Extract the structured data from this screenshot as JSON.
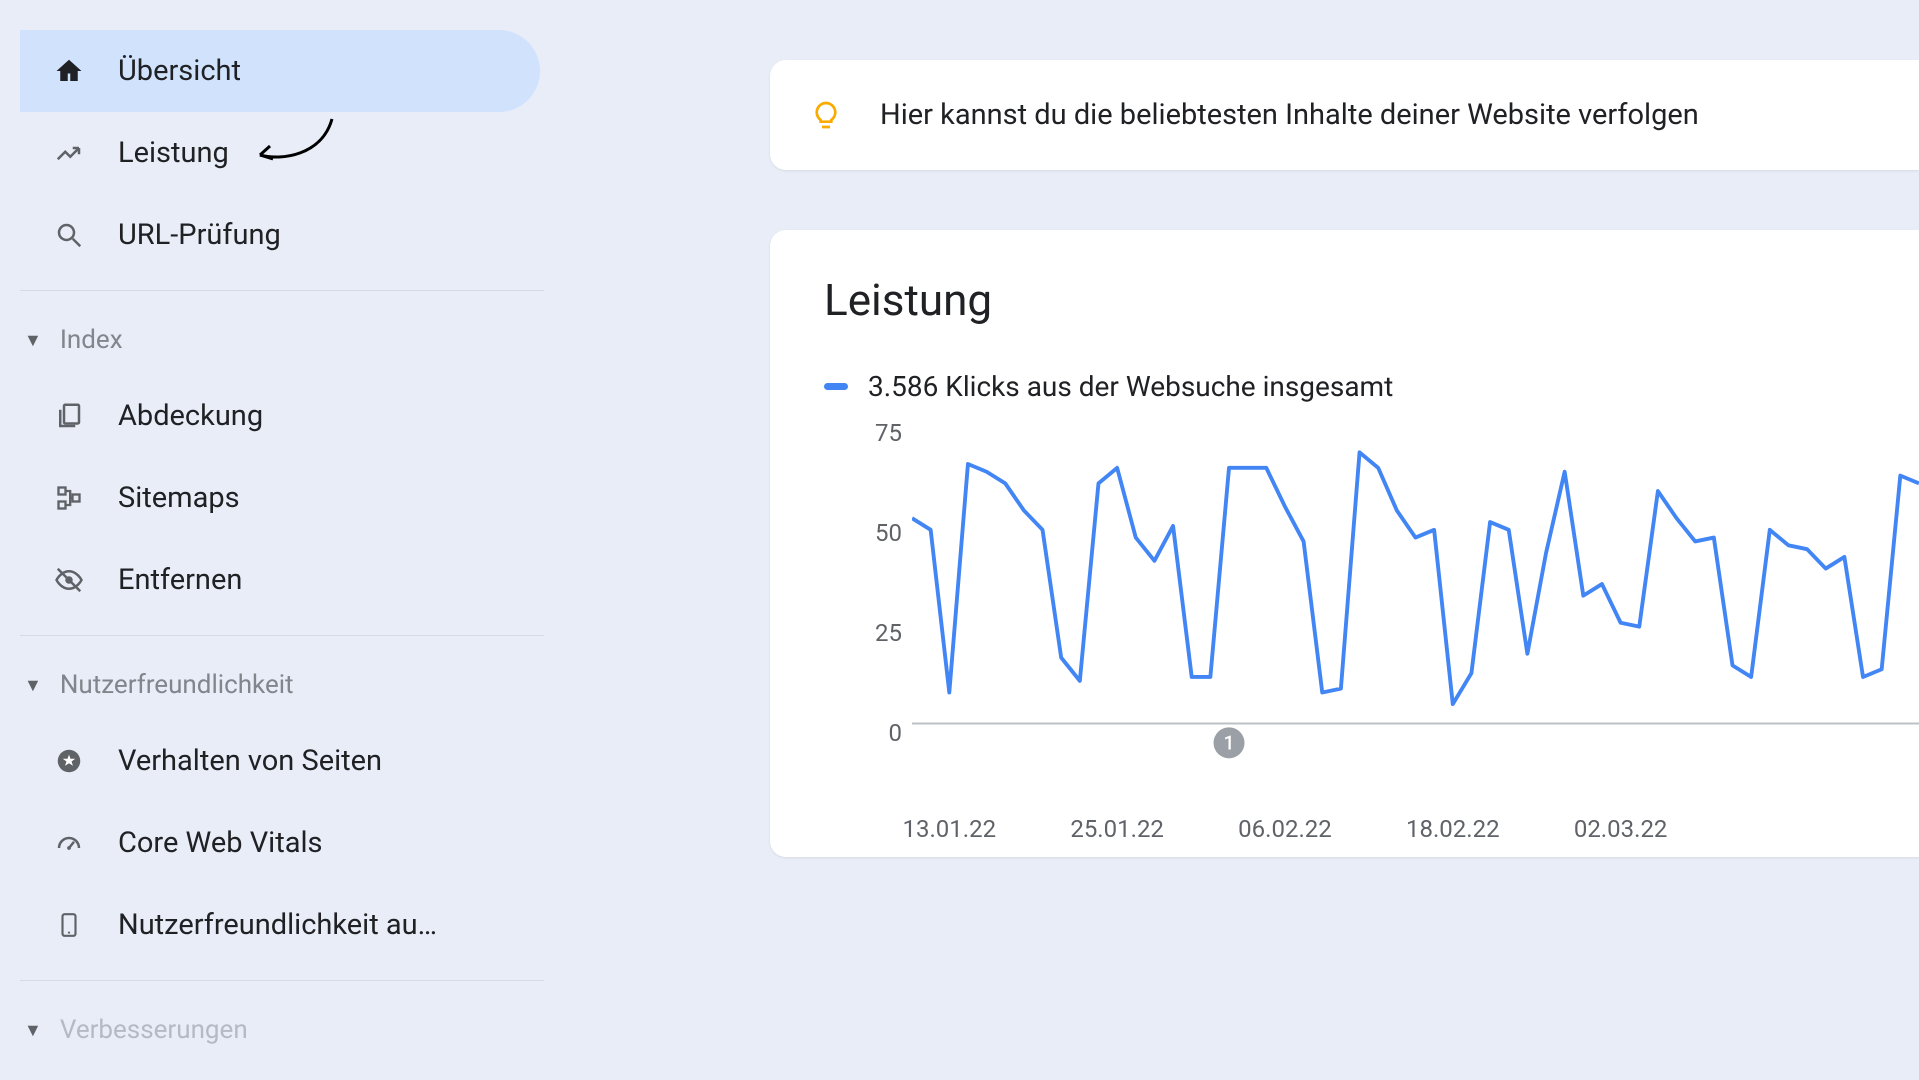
{
  "sidebar": {
    "main_items": [
      {
        "label": "Übersicht",
        "icon": "home-icon",
        "selected": true
      },
      {
        "label": "Leistung",
        "icon": "trending-icon",
        "selected": false
      },
      {
        "label": "URL-Prüfung",
        "icon": "search-icon",
        "selected": false
      }
    ],
    "sections": [
      {
        "title": "Index",
        "items": [
          {
            "label": "Abdeckung",
            "icon": "copy-icon"
          },
          {
            "label": "Sitemaps",
            "icon": "sitemap-icon"
          },
          {
            "label": "Entfernen",
            "icon": "visibility-off-icon"
          }
        ]
      },
      {
        "title": "Nutzerfreundlichkeit",
        "items": [
          {
            "label": "Verhalten von Seiten",
            "icon": "stars-icon"
          },
          {
            "label": "Core Web Vitals",
            "icon": "speedometer-icon"
          },
          {
            "label": "Nutzerfreundlichkeit au…",
            "icon": "smartphone-icon"
          }
        ]
      },
      {
        "title": "Verbesserungen",
        "items": []
      }
    ]
  },
  "tip": {
    "text": "Hier kannst du die beliebtesten Inhalte deiner Website verfolgen"
  },
  "performance": {
    "title": "Leistung",
    "legend": "3.586 Klicks aus der Websuche insgesamt",
    "marker_label": "1"
  },
  "chart_data": {
    "type": "line",
    "ylabel": "",
    "ylim": [
      0,
      75
    ],
    "yticks": [
      0,
      25,
      50,
      75
    ],
    "categories": [
      "13.01.22",
      "25.01.22",
      "06.02.22",
      "18.02.22",
      "02.03.22"
    ],
    "x": [
      0,
      1,
      2,
      3,
      4,
      5,
      6,
      7,
      8,
      9,
      10,
      11,
      12,
      13,
      14,
      15,
      16,
      17,
      18,
      19,
      20,
      21,
      22,
      23,
      24,
      25,
      26,
      27,
      28,
      29,
      30,
      31,
      32,
      33,
      34,
      35,
      36,
      37,
      38,
      39,
      40,
      41,
      42,
      43,
      44,
      45,
      46,
      47,
      48,
      49,
      50,
      51,
      52,
      53,
      54
    ],
    "x_tick_index": [
      2,
      11,
      20,
      29,
      38
    ],
    "values": [
      53,
      50,
      8,
      67,
      65,
      62,
      55,
      50,
      17,
      11,
      62,
      66,
      48,
      42,
      51,
      12,
      12,
      66,
      66,
      66,
      56,
      47,
      8,
      9,
      70,
      66,
      55,
      48,
      50,
      5,
      13,
      52,
      50,
      18,
      44,
      65,
      33,
      36,
      26,
      25,
      60,
      53,
      47,
      48,
      15,
      12,
      50,
      46,
      45,
      40,
      43,
      12,
      14,
      64,
      62
    ],
    "marker_index": 17
  }
}
